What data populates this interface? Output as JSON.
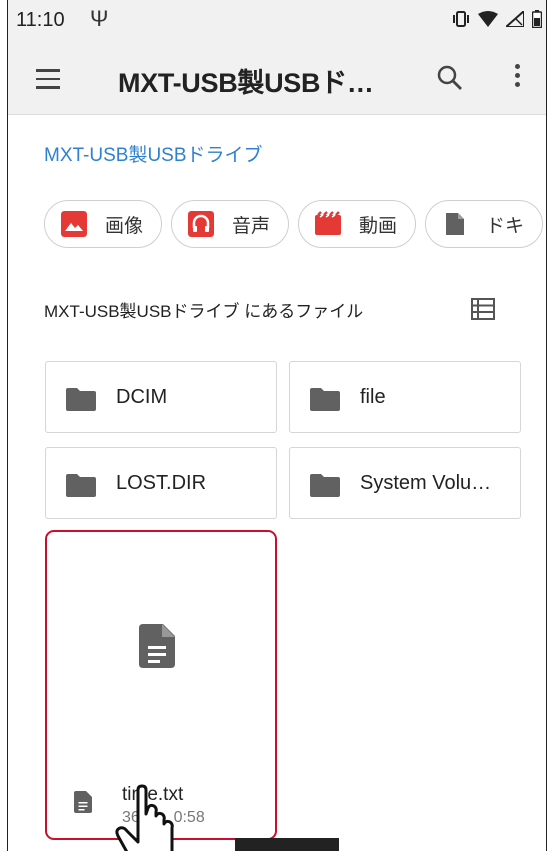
{
  "status": {
    "time": "11:10"
  },
  "app": {
    "title": "MXT-USB製USBド…"
  },
  "breadcrumb": "MXT-USB製USBドライブ",
  "chips": [
    {
      "label": "画像",
      "icon": "image-icon",
      "color": "#e53935"
    },
    {
      "label": "音声",
      "icon": "headphones-icon",
      "color": "#e53935"
    },
    {
      "label": "動画",
      "icon": "video-icon",
      "color": "#e53935"
    },
    {
      "label": "ドキ",
      "icon": "document-icon",
      "color": "#616161"
    }
  ],
  "section": {
    "label": "MXT-USB製USBドライブ にあるファイル"
  },
  "folders": [
    {
      "name": "DCIM"
    },
    {
      "name": "file"
    },
    {
      "name": "LOST.DIR"
    },
    {
      "name": "System Volu…"
    }
  ],
  "file": {
    "name": "time.txt",
    "meta": "364 … 0:58"
  },
  "colors": {
    "accent": "#2f80d0",
    "highlight": "#c8102e"
  }
}
